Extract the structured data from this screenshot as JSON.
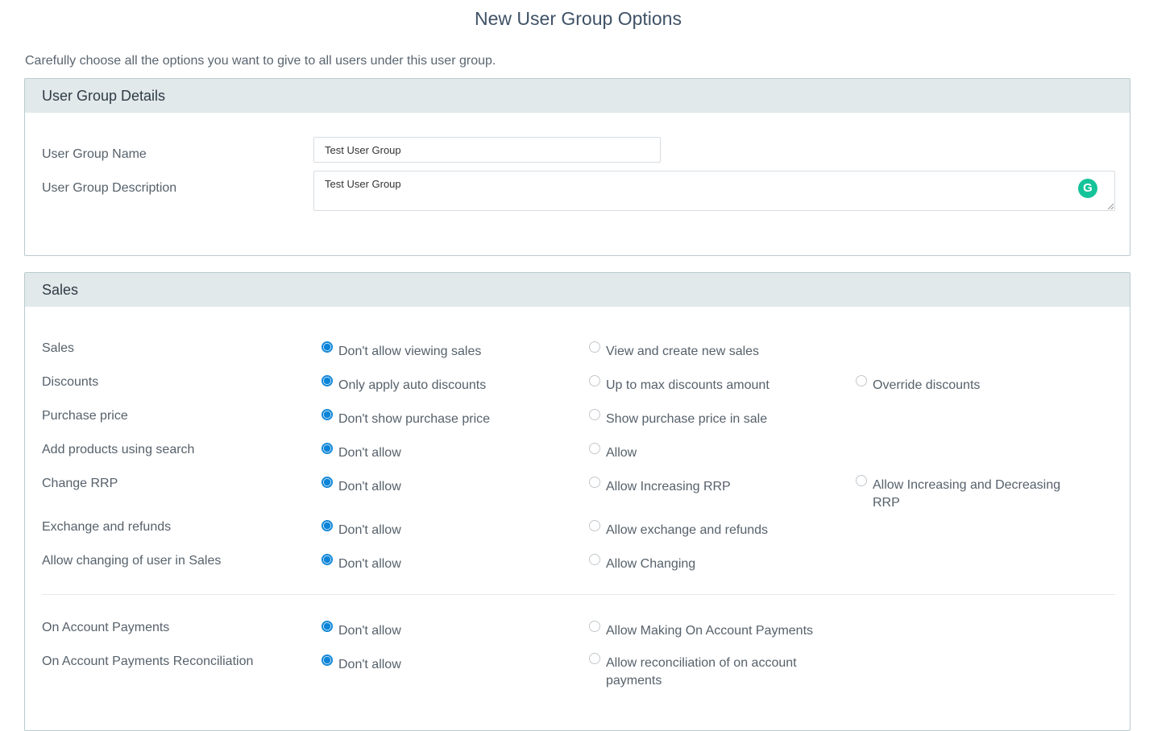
{
  "page": {
    "title": "New User Group Options",
    "intro": "Carefully choose all the options you want to give to all users under this user group."
  },
  "details": {
    "heading": "User Group Details",
    "name_label": "User Group Name",
    "name_value": "Test User Group",
    "description_label": "User Group Description",
    "description_value": "Test User Group",
    "grammarly_icon": "G"
  },
  "sales": {
    "heading": "Sales",
    "rows": [
      {
        "label": "Sales",
        "options": [
          "Don't allow viewing sales",
          "View and create new sales"
        ],
        "selected": 0
      },
      {
        "label": "Discounts",
        "options": [
          "Only apply auto discounts",
          "Up to max discounts amount",
          "Override discounts"
        ],
        "selected": 0
      },
      {
        "label": "Purchase price",
        "options": [
          "Don't show purchase price",
          "Show purchase price in sale"
        ],
        "selected": 0
      },
      {
        "label": "Add products using search",
        "options": [
          "Don't allow",
          "Allow"
        ],
        "selected": 0
      },
      {
        "label": "Change RRP",
        "options": [
          "Don't allow",
          "Allow Increasing RRP",
          "Allow Increasing and Decreasing RRP"
        ],
        "selected": 0
      },
      {
        "label": "Exchange and refunds",
        "options": [
          "Don't allow",
          "Allow exchange and refunds"
        ],
        "selected": 0
      },
      {
        "label": "Allow changing of user in Sales",
        "options": [
          "Don't allow",
          "Allow Changing"
        ],
        "selected": 0
      },
      {
        "label": "On Account Payments",
        "options": [
          "Don't allow",
          "Allow Making On Account Payments"
        ],
        "selected": 0
      },
      {
        "label": "On Account Payments Reconciliation",
        "options": [
          "Don't allow",
          "Allow reconciliation of on account payments"
        ],
        "selected": 0
      }
    ]
  },
  "colors": {
    "accent": "#0a84d8",
    "panel_header": "#e1e9eb",
    "panel_border": "#b9cbcf"
  }
}
